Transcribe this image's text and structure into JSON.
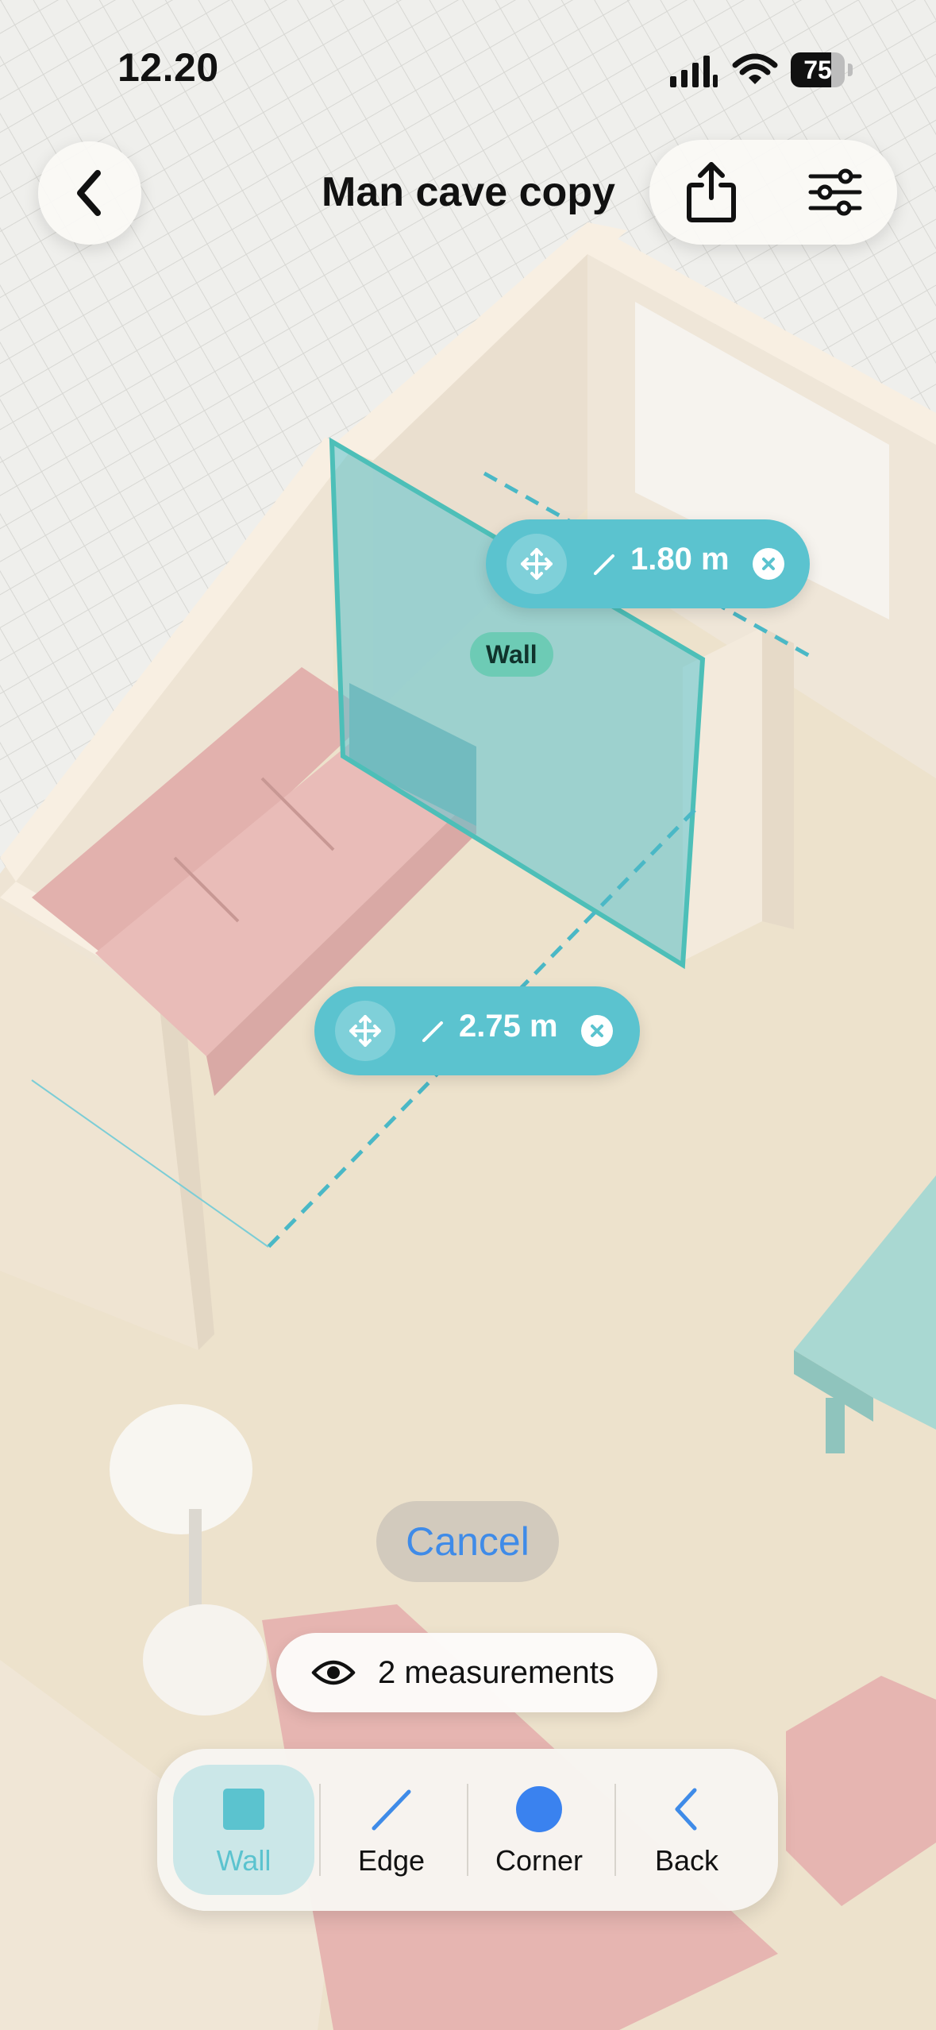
{
  "status_bar": {
    "time": "12.20",
    "battery": "75"
  },
  "header": {
    "title": "Man cave copy",
    "back_icon": "chevron-left-icon",
    "share_icon": "share-icon",
    "settings_icon": "sliders-icon"
  },
  "measurements": [
    {
      "value": "1.80 m",
      "icons": [
        "move-icon",
        "pencil-icon",
        "close-icon"
      ]
    },
    {
      "value": "2.75 m",
      "icons": [
        "move-icon",
        "pencil-icon",
        "close-icon"
      ]
    }
  ],
  "selection_tag": "Wall",
  "cancel_label": "Cancel",
  "measurements_toggle": {
    "label": "2 measurements",
    "icon": "eye-icon"
  },
  "toolbar": {
    "tools": [
      {
        "label": "Wall",
        "icon": "wall-square-icon",
        "active": true
      },
      {
        "label": "Edge",
        "icon": "edge-line-icon",
        "active": false
      },
      {
        "label": "Corner",
        "icon": "corner-dot-icon",
        "active": false
      },
      {
        "label": "Back",
        "icon": "chevron-left-icon",
        "active": false
      }
    ]
  },
  "colors": {
    "accent": "#5bc3cf",
    "link": "#3f8be8",
    "corner": "#3a82ef",
    "floor": "#ede2cc",
    "sofa": "#e7b6b2",
    "wall_top": "#f7eee2"
  }
}
